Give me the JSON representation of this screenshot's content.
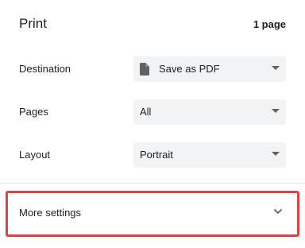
{
  "header": {
    "title": "Print",
    "page_count": "1 page"
  },
  "destination": {
    "label": "Destination",
    "value": "Save as PDF",
    "icon": "pdf-file-icon"
  },
  "pages": {
    "label": "Pages",
    "value": "All"
  },
  "layout": {
    "label": "Layout",
    "value": "Portrait"
  },
  "more_settings": {
    "label": "More settings",
    "icon": "chevron-down-icon",
    "highlight_color": "#e0403f"
  }
}
